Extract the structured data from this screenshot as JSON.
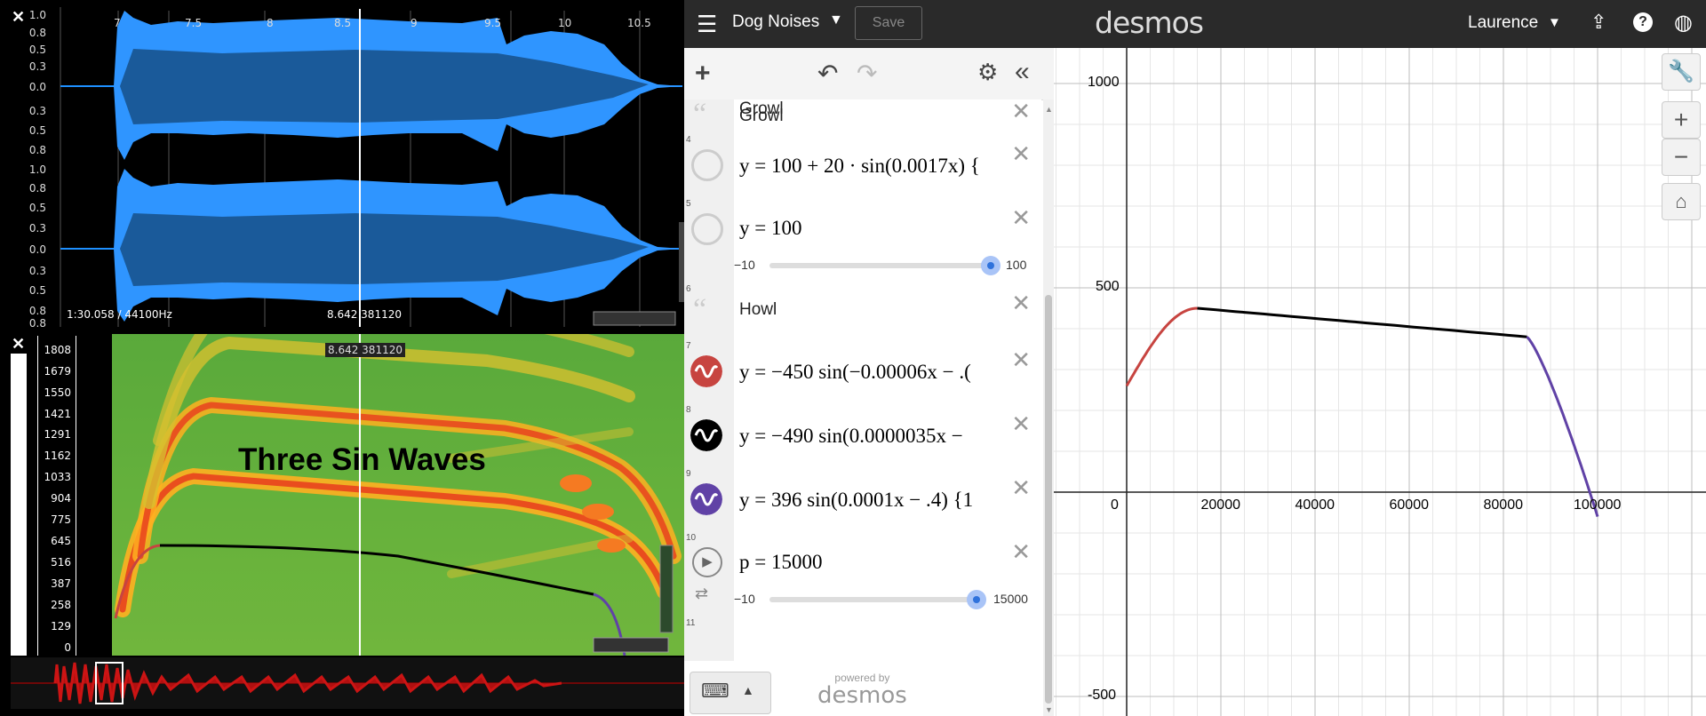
{
  "waveform": {
    "y_labels": [
      "1.0",
      "0.8",
      "0.5",
      "0.3",
      "0.0",
      "0.3",
      "0.5",
      "0.8",
      "1.0",
      "0.8",
      "0.5",
      "0.3",
      "0.0",
      "0.3",
      "0.5",
      "0.8",
      "0.8"
    ],
    "x_labels": [
      "7",
      "7.5",
      "8",
      "8.5",
      "9",
      "9.5",
      "10",
      "10.5"
    ],
    "info": "1:30.058 / 44100Hz",
    "cursor_readout": "8.642  381120"
  },
  "spectrogram": {
    "cursor_readout": "8.642  381120",
    "freq_labels": [
      "1808",
      "1679",
      "1550",
      "1421",
      "1291",
      "1162",
      "1033",
      "904",
      "775",
      "645",
      "516",
      "387",
      "258",
      "129",
      "0"
    ],
    "title": "Three Sin Waves"
  },
  "desmos": {
    "graph_title": "Dog Noises",
    "save_label": "Save",
    "logo": "desmos",
    "user": "Laurence",
    "expressions": [
      {
        "num": "",
        "type": "note",
        "text": "Growl"
      },
      {
        "num": "4",
        "type": "expr",
        "text": "y = 100 + 20 · sin(0.0017x) {"
      },
      {
        "num": "5",
        "type": "expr",
        "text": "y = 100"
      },
      {
        "num": "6",
        "type": "note",
        "text": "Howl"
      },
      {
        "num": "7",
        "type": "expr",
        "text": "y = −450 sin(−0.00006x − .("
      },
      {
        "num": "8",
        "type": "expr",
        "text": "y = −490 sin(0.0000035x −"
      },
      {
        "num": "9",
        "type": "expr",
        "text": "y = 396 sin(0.0001x − .4) {1"
      },
      {
        "num": "10",
        "type": "expr",
        "text": "p = 15000"
      },
      {
        "num": "11",
        "type": "empty",
        "text": ""
      }
    ],
    "slider_y": {
      "min": "−10",
      "max": "100",
      "value": 100
    },
    "slider_p": {
      "min": "−10",
      "max": "15000",
      "value": 15000
    },
    "powered_by": "powered by",
    "powered_logo": "desmos",
    "graph": {
      "x_ticks": [
        "0",
        "20000",
        "40000",
        "60000",
        "80000",
        "100000"
      ],
      "y_ticks": [
        "1000",
        "500",
        "-500"
      ]
    },
    "curve_colors": {
      "red": "#c74440",
      "black": "#000000",
      "purple": "#6042a6"
    }
  }
}
